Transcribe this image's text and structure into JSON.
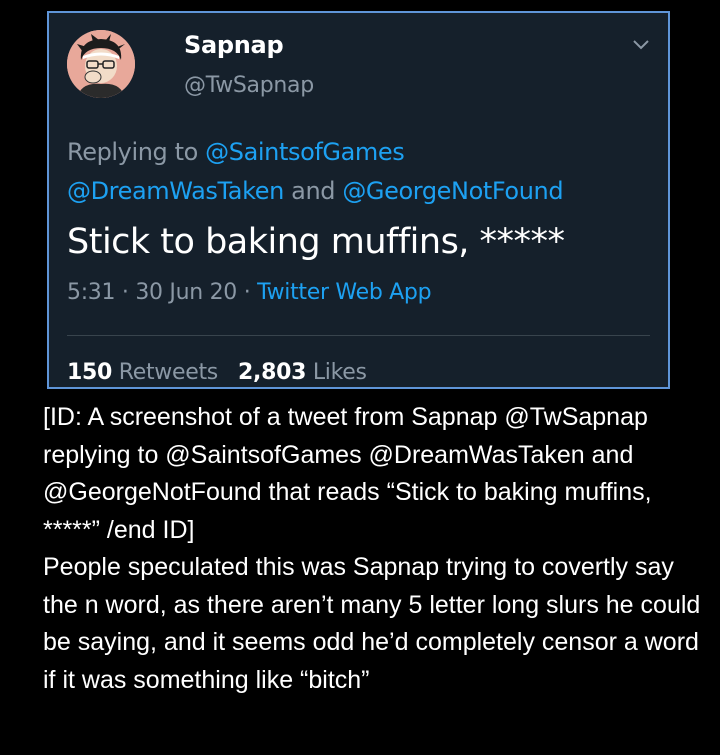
{
  "tweet": {
    "display_name": "Sapnap",
    "handle": "@TwSapnap",
    "replying_label": "Replying to",
    "reply_mention_1": "@SaintsofGames",
    "reply_mention_2": "@DreamWasTaken",
    "reply_and": "and",
    "reply_mention_3": "@GeorgeNotFound",
    "text": "Stick to baking muffins, *****",
    "time": "5:31",
    "date": "30 Jun 20",
    "separator": "·",
    "source": "Twitter Web App",
    "retweets_count": "150",
    "retweets_label": "Retweets",
    "likes_count": "2,803",
    "likes_label": "Likes",
    "icons": {
      "avatar": "avatar-image",
      "menu": "chevron-down-icon"
    },
    "colors": {
      "background": "#15202b",
      "border": "#5f95d8",
      "link": "#1da1f2",
      "muted": "#8b98a5"
    }
  },
  "caption": {
    "id_text": "[ID: A screenshot of a tweet from Sapnap @TwSapnap replying to @SaintsofGames @DreamWasTaken and @GeorgeNotFound that reads “Stick to baking muffins, *****” /end ID]",
    "body_text": "People speculated this was Sapnap trying to covertly say the n word, as there aren’t many 5 letter long slurs he could be saying, and it seems odd he’d completely censor a word if it was something like “bitch”"
  }
}
